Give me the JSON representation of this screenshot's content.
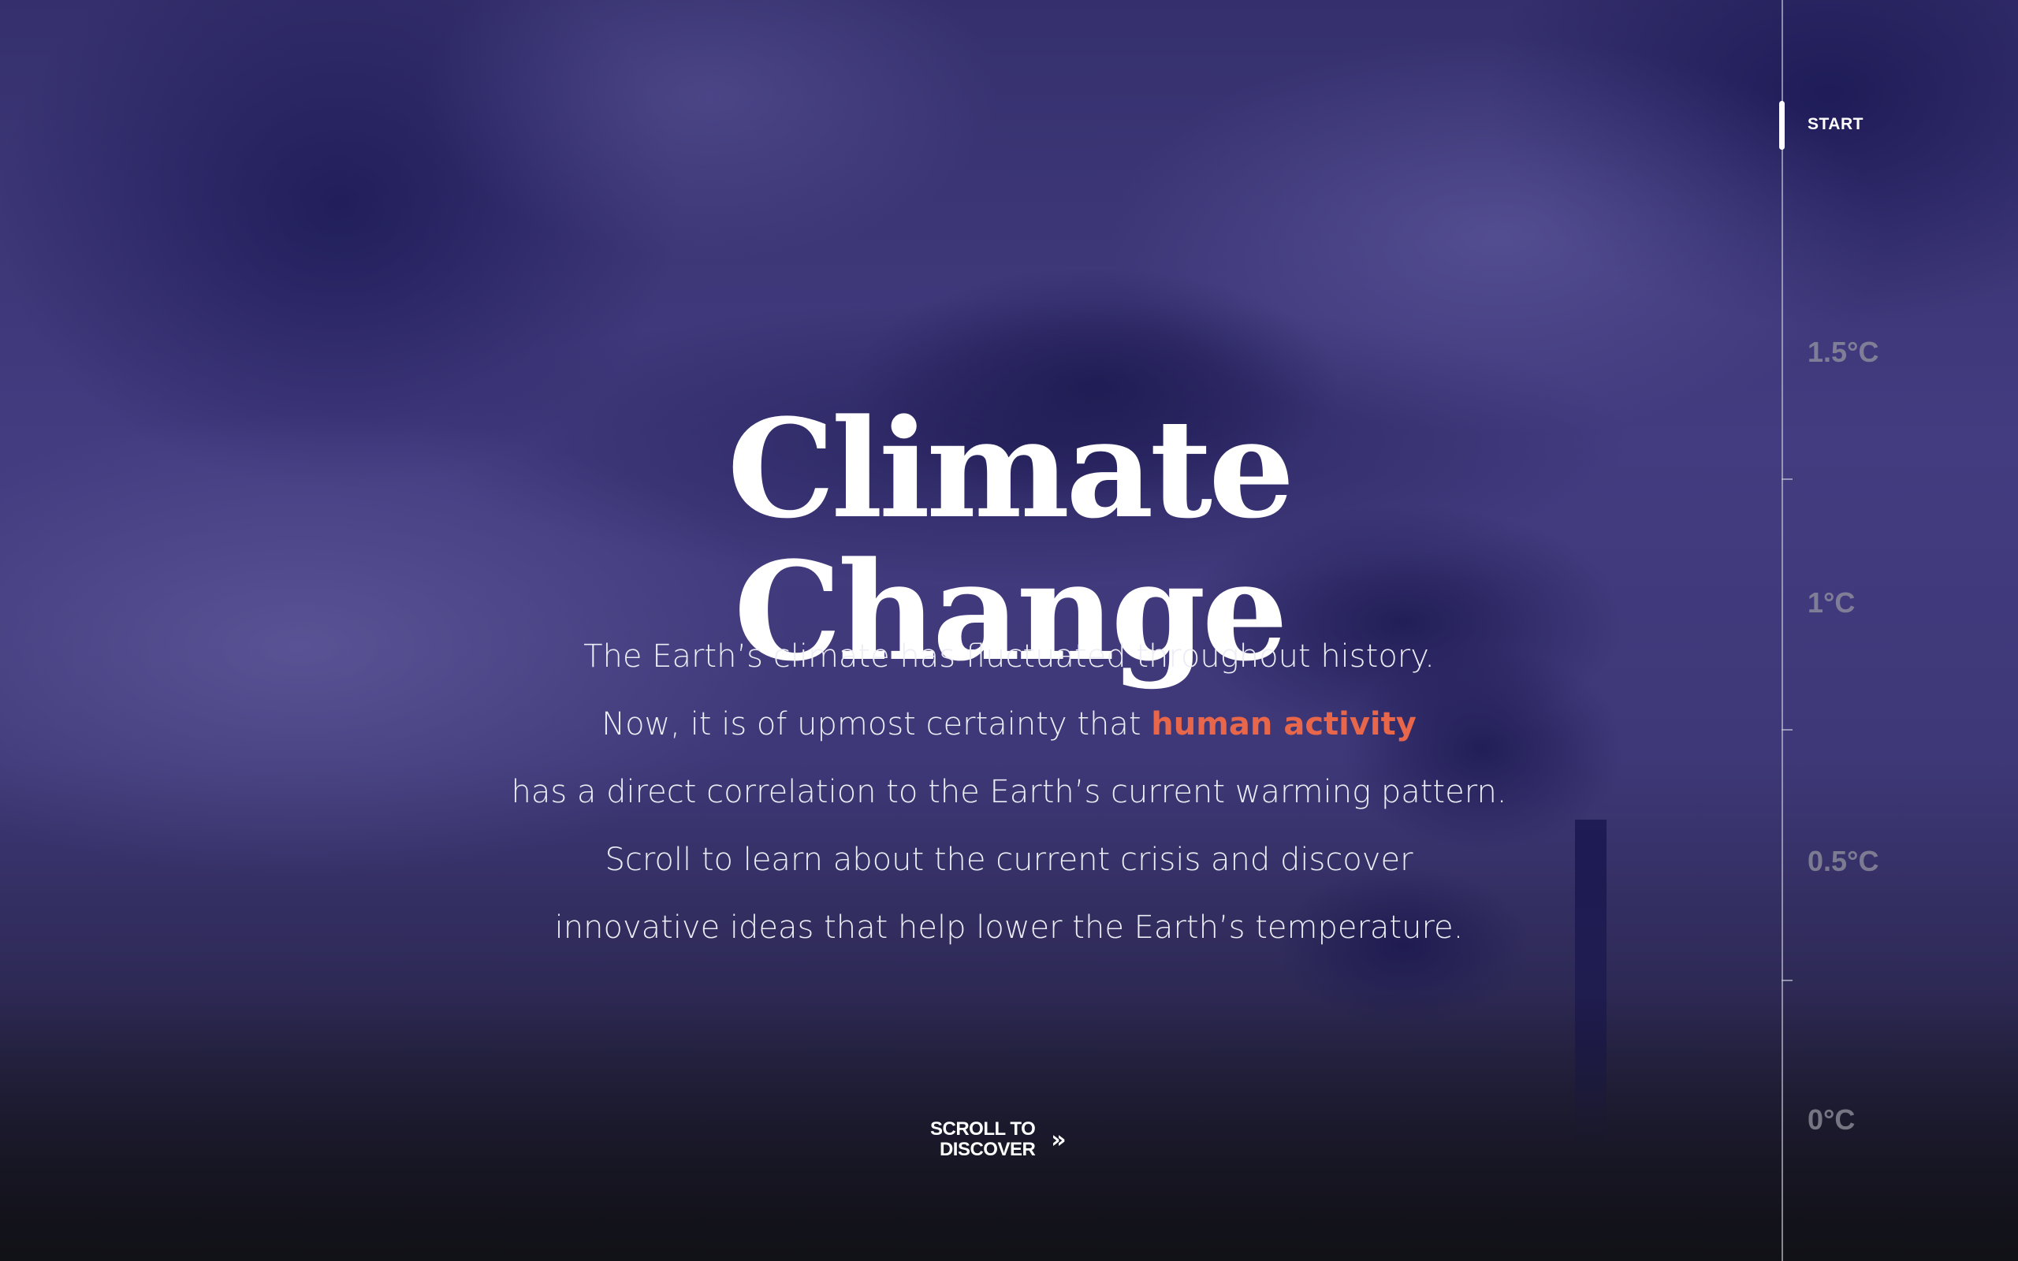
{
  "hero": {
    "title": "Climate Change",
    "intro_lines": [
      "The Earth’s climate has fluctuated throughout history.",
      "Now, it is of upmost certainty that ",
      "has a direct correlation to the Earth’s current warming pattern.",
      "Scroll to learn about the current crisis and discover",
      "innovative ideas that help lower the Earth’s temperature."
    ],
    "highlight": "human activity"
  },
  "scroll_cue": {
    "line1": "SCROLL TO",
    "line2": "DISCOVER",
    "icon": "double-chevron-right-icon"
  },
  "temperature_nav": {
    "start_label": "START",
    "items": [
      "1.5°C",
      "1°C",
      "0.5°C",
      "0°C"
    ],
    "active": "START"
  },
  "colors": {
    "highlight": "#e8674a",
    "background": "#3a3474",
    "text": "#ffffff",
    "rail_label": "#96949f"
  }
}
